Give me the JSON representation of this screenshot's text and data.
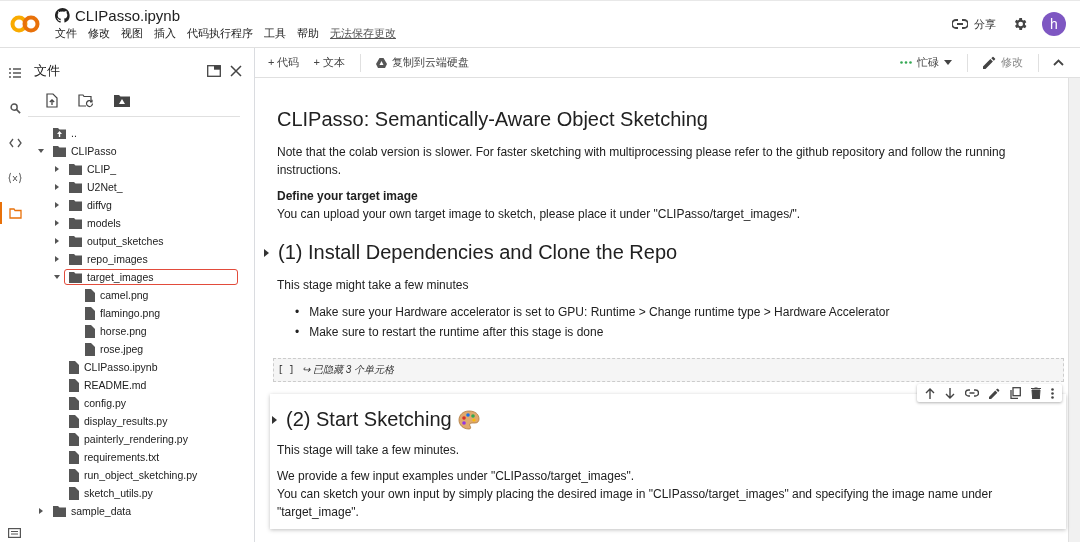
{
  "header": {
    "title": "CLIPasso.ipynb",
    "menu": [
      "文件",
      "修改",
      "视图",
      "插入",
      "代码执行程序",
      "工具",
      "帮助"
    ],
    "save_link": "无法保存更改",
    "share": "分享",
    "avatar": "h"
  },
  "rail": [
    {
      "kind": "toc",
      "selected": false
    },
    {
      "kind": "search",
      "selected": false
    },
    {
      "kind": "code",
      "selected": false
    },
    {
      "kind": "variables",
      "selected": false
    },
    {
      "kind": "files",
      "selected": true
    }
  ],
  "files": {
    "title": "文件",
    "tree": [
      {
        "name": "..",
        "kind": "parent",
        "highlighted": false
      },
      {
        "name": "CLIPasso",
        "kind": "folder",
        "expanded": true,
        "highlighted": false,
        "children": [
          {
            "name": "CLIP_",
            "kind": "folder",
            "expanded": false,
            "highlighted": false
          },
          {
            "name": "U2Net_",
            "kind": "folder",
            "expanded": false,
            "highlighted": false
          },
          {
            "name": "diffvg",
            "kind": "folder",
            "expanded": false,
            "highlighted": false
          },
          {
            "name": "models",
            "kind": "folder",
            "expanded": false,
            "highlighted": false
          },
          {
            "name": "output_sketches",
            "kind": "folder",
            "expanded": false,
            "highlighted": false
          },
          {
            "name": "repo_images",
            "kind": "folder",
            "expanded": false,
            "highlighted": false
          },
          {
            "name": "target_images",
            "kind": "folder",
            "expanded": true,
            "highlighted": true,
            "children": [
              {
                "name": "camel.png",
                "kind": "file",
                "highlighted": false
              },
              {
                "name": "flamingo.png",
                "kind": "file",
                "highlighted": false
              },
              {
                "name": "horse.png",
                "kind": "file",
                "highlighted": false
              },
              {
                "name": "rose.jpeg",
                "kind": "file",
                "highlighted": false
              }
            ]
          },
          {
            "name": "CLIPasso.ipynb",
            "kind": "file",
            "highlighted": false
          },
          {
            "name": "README.md",
            "kind": "file",
            "highlighted": false
          },
          {
            "name": "config.py",
            "kind": "file",
            "highlighted": false
          },
          {
            "name": "display_results.py",
            "kind": "file",
            "highlighted": false
          },
          {
            "name": "painterly_rendering.py",
            "kind": "file",
            "highlighted": false
          },
          {
            "name": "requirements.txt",
            "kind": "file",
            "highlighted": false
          },
          {
            "name": "run_object_sketching.py",
            "kind": "file",
            "highlighted": false
          },
          {
            "name": "sketch_utils.py",
            "kind": "file",
            "highlighted": false
          }
        ]
      },
      {
        "name": "sample_data",
        "kind": "folder",
        "expanded": false,
        "highlighted": false
      }
    ]
  },
  "toolbar": {
    "add_code": "+ 代码",
    "add_text": "+ 文本",
    "copy_drive": "复制到云端硬盘",
    "status": "忙碌",
    "edit": "修改",
    "edit_disabled": true
  },
  "cells": [
    {
      "kind": "text",
      "focused": false,
      "blocks": [
        {
          "kind": "title",
          "text": "CLIPasso: Semantically-Aware Object Sketching"
        },
        {
          "kind": "p",
          "text": "Note that the colab version is slower. For faster sketching with multiprocessing please refer to the github repository and follow the running instructions."
        },
        {
          "kind": "p",
          "text": "**Define your target image**\nYou can upload your own target image to sketch, please place it under \"CLIPasso/target_images/\"."
        },
        {
          "kind": "section",
          "text": "(1) Install Dependencies and Clone the Repo"
        },
        {
          "kind": "p",
          "text": "This stage might take a few minutes"
        },
        {
          "kind": "bullets",
          "marker": "•",
          "items": [
            "Make sure your Hardware accelerator is set to GPU: Runtime > Change runtime type > Hardware Accelerator",
            "Make sure to restart the runtime after this stage is done"
          ]
        }
      ]
    },
    {
      "kind": "hidden",
      "brackets": "[ ]",
      "text": "↪ 已隐藏 3 个单元格"
    },
    {
      "kind": "text",
      "focused": true,
      "blocks": [
        {
          "kind": "iconsection",
          "text": "(2) Start Sketching"
        },
        {
          "kind": "p",
          "text": "This stage will take a few minutes."
        },
        {
          "kind": "p",
          "text": "We provide a few input examples under \"CLIPasso/target_images\".\nYou can sketch your own input by simply placing the desired image in \"CLIPasso/target_images\" and specifying the image name under \"target_image\"."
        }
      ]
    }
  ]
}
